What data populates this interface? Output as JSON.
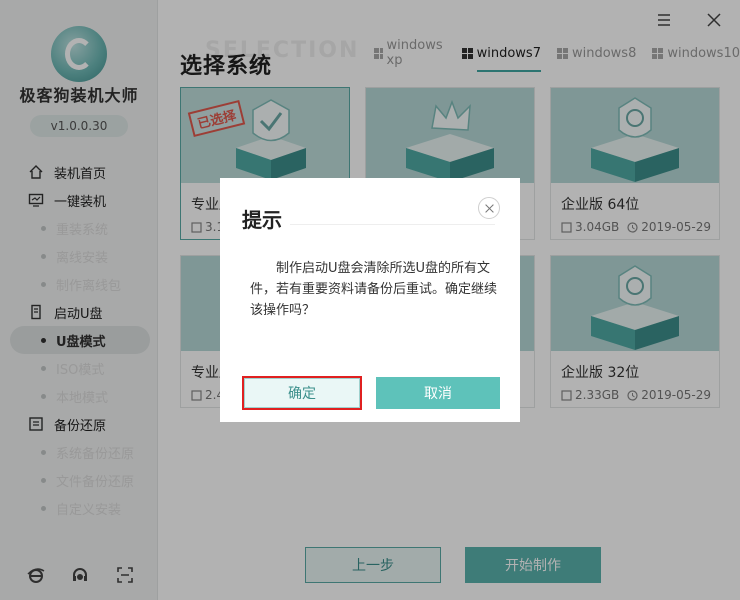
{
  "app": {
    "title": "极客狗装机大师",
    "version": "v1.0.0.30"
  },
  "sidebar": {
    "sections": [
      {
        "label": "装机首页",
        "icon": "home-icon",
        "items": []
      },
      {
        "label": "一键装机",
        "icon": "monitor-icon",
        "items": [
          "重装系统",
          "离线安装",
          "制作离线包"
        ]
      },
      {
        "label": "启动U盘",
        "icon": "usb-drive-icon",
        "items": [
          "U盘模式",
          "ISO模式",
          "本地模式"
        ],
        "active_item": "U盘模式"
      },
      {
        "label": "备份还原",
        "icon": "backup-restore-icon",
        "items": [
          "系统备份还原",
          "文件备份还原",
          "自定义安装"
        ]
      }
    ],
    "bottom_icons": [
      "ie-browser-icon",
      "customer-service-icon",
      "fullscreen-icon"
    ]
  },
  "window_controls": [
    "menu-icon",
    "close-icon"
  ],
  "main": {
    "title": "选择系统",
    "title_watermark": "SELECTION",
    "os_tabs": [
      {
        "label": "windows xp",
        "active": false
      },
      {
        "label": "windows7",
        "active": true
      },
      {
        "label": "windows8",
        "active": false
      },
      {
        "label": "windows10",
        "active": false
      }
    ],
    "cards": [
      {
        "title": "专业版",
        "size": "3.1",
        "date": "",
        "selected": true,
        "stamp": "已选择",
        "icon": "checkmark-shield-icon"
      },
      {
        "title": "",
        "size": "",
        "date": "",
        "selected": false,
        "stamp": "",
        "icon": "crown-icon"
      },
      {
        "title": "企业版 64位",
        "size": "3.04GB",
        "date": "2019-05-29",
        "selected": false,
        "stamp": "",
        "icon": "enterprise-shield-icon"
      },
      {
        "title": "专业版",
        "size": "2.4",
        "date": "",
        "selected": false,
        "stamp": "",
        "icon": "checkmark-shield-icon"
      },
      {
        "title": "",
        "size": "",
        "date": "",
        "selected": false,
        "stamp": "",
        "icon": "crown-icon"
      },
      {
        "title": "企业版 32位",
        "size": "2.33GB",
        "date": "2019-05-29",
        "selected": false,
        "stamp": "",
        "icon": "enterprise-shield-icon"
      }
    ],
    "buttons": {
      "prev": "上一步",
      "start": "开始制作"
    }
  },
  "dialog": {
    "title": "提示",
    "message": "制作启动U盘会清除所选U盘的所有文件，若有重要资料请备份后重试。确定继续该操作吗？",
    "confirm": "确定",
    "cancel": "取消"
  },
  "colors": {
    "accent": "#5ab2ad",
    "accent_dark": "#3b8f8b",
    "highlight_border": "#e02020",
    "stamp": "#e05a4e"
  }
}
